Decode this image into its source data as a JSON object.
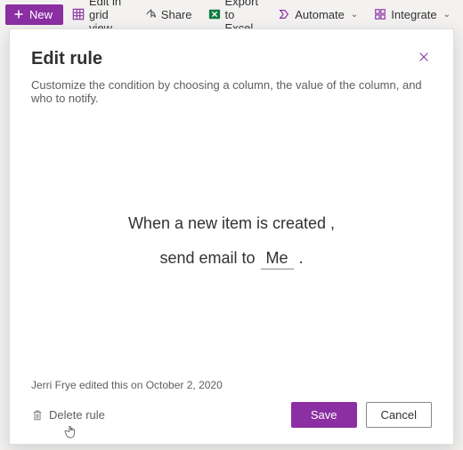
{
  "toolbar": {
    "new_label": "New",
    "edit_grid_label": "Edit in grid view",
    "share_label": "Share",
    "export_label": "Export to Excel",
    "automate_label": "Automate",
    "integrate_label": "Integrate"
  },
  "modal": {
    "title": "Edit rule",
    "subtitle": "Customize the condition by choosing a column, the value of the column, and who to notify.",
    "rule_line1": "When a new item is created ,",
    "rule_send_prefix": "send email to",
    "rule_recipient": "Me",
    "rule_period": ".",
    "meta": "Jerri Frye edited this on October 2, 2020",
    "delete_label": "Delete rule",
    "save_label": "Save",
    "cancel_label": "Cancel"
  }
}
